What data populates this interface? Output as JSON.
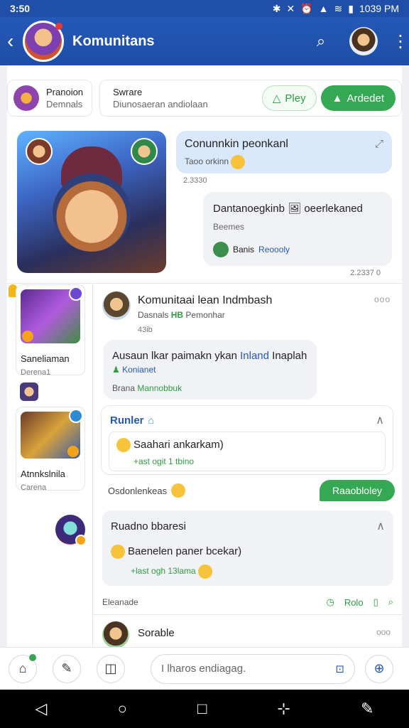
{
  "status": {
    "time": "3:50",
    "right": "1039 PM",
    "icons": [
      "bluetooth-icon",
      "mute-icon",
      "alarm-icon",
      "signal-icon",
      "wifi-icon",
      "battery-icon"
    ]
  },
  "header": {
    "title": "Komunitans",
    "back_icon": "back-arrow-icon",
    "search_icon": "search-icon",
    "more_icon": "more-vert-icon"
  },
  "pinned": {
    "first_title": "Pranoion",
    "first_sub": "Demnals",
    "second_title": "Swrare",
    "second_sub": "Diunosaeran andiolaan",
    "play_label": "Pley",
    "add_label": "Ardedet"
  },
  "messages": {
    "b1_title": "Conunnkin peonkanl",
    "b1_sub": "Taoo orkinn",
    "b1_time": "2.3330",
    "b2_title": "Dantanoegkinb",
    "b2_title_tail": "oeerlekaned",
    "b2_sub": "Beemes",
    "b2_foot_name": "Banis",
    "b2_foot_link": "Reoooly",
    "b2_time": "2.2337 0"
  },
  "sidebar": {
    "card1_name": "Saneliaman",
    "card1_sub": "Derena1",
    "card2_name": "Atnnkslnila",
    "card2_sub": "Carena"
  },
  "post": {
    "title": "Komunitaai lean Indmbash",
    "sub_a": "Dasnals",
    "sub_b": "HB",
    "sub_c": "Pemonhar",
    "time": "43ib",
    "dots": "ooo",
    "bubble_text": "Ausaun lkar paimakn ykan",
    "bubble_blue": "Inland",
    "bubble_tail": "Inaplah",
    "bubble_sub": "Konianet",
    "bubble_foot": "Brana",
    "bubble_foot_green": "Mannobbuk"
  },
  "panel": {
    "header": "Runler",
    "text": "Saahari ankarkam)",
    "green": "+ast ogit 1 tbino",
    "react_label": "Osdonlenkeas",
    "cta": "Raaobloley"
  },
  "panel2": {
    "header": "Ruadno bbaresi",
    "text": "Baenelen paner bcekar)",
    "green": "+last ogh 13lama"
  },
  "footer": {
    "label": "Eleanade",
    "act": "Rolo"
  },
  "next_post": {
    "title": "Sorable",
    "dots": "ooo"
  },
  "composer": {
    "placeholder": "I lharos endiagag."
  }
}
